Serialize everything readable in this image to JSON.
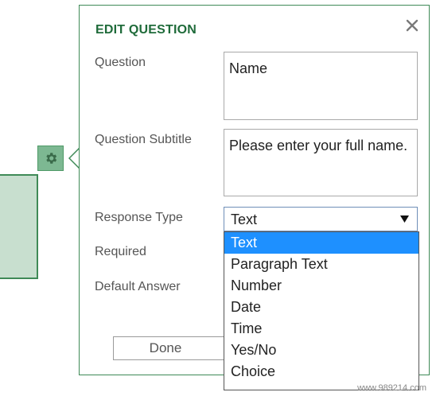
{
  "dialog": {
    "title": "EDIT QUESTION",
    "close_icon": "close-icon"
  },
  "fields": {
    "question_label": "Question",
    "question_value": "Name",
    "subtitle_label": "Question Subtitle",
    "subtitle_value": "Please enter your full name.",
    "response_type_label": "Response Type",
    "response_type_value": "Text",
    "required_label": "Required",
    "default_answer_label": "Default Answer"
  },
  "dropdown": {
    "options": [
      "Text",
      "Paragraph Text",
      "Number",
      "Date",
      "Time",
      "Yes/No",
      "Choice"
    ],
    "selected": "Text"
  },
  "buttons": {
    "done_label": "Done"
  },
  "icons": {
    "gear": "gear-icon",
    "dropdown_arrow": "triangle-down-icon"
  },
  "colors": {
    "accent": "#1f6b3a",
    "border_green": "#3f8a57",
    "gear_bg": "#7db892",
    "card_bg": "#c8dfcf",
    "selection": "#1e90ff"
  },
  "watermark": "www.989214.com"
}
